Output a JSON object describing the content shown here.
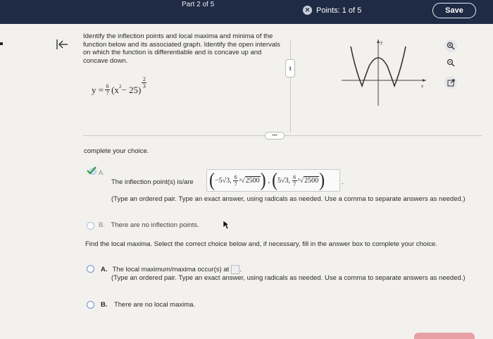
{
  "header": {
    "part_label": "Part 2 of 5",
    "points_label": "Points: 1 of 5",
    "save_label": "Save"
  },
  "problem": {
    "text": "Identify the inflection points and local maxima and minima of the function below and its associated graph. Identify the open intervals on which the function is differentiable and is concave up and concave down.",
    "formula": {
      "lhs": "y =",
      "coef_num": "6",
      "coef_den": "7",
      "base": "(x",
      "sq": "2",
      "rest": " − 25)",
      "exp_num": "2",
      "exp_den": "3"
    }
  },
  "graph": {
    "y_label": "y",
    "x_label": "x"
  },
  "complete_prompt": "complete your choice.",
  "inflection": {
    "option_letter": "A.",
    "label": "The inflection point(s) is/are",
    "points": [
      {
        "x": "−5√3",
        "y_num": "6",
        "y_den": "7",
        "y_idx": "3",
        "y_rad": "2500"
      },
      {
        "x": "5√3",
        "y_num": "6",
        "y_den": "7",
        "y_idx": "3",
        "y_rad": "2500"
      }
    ],
    "separator": ",",
    "end": ".",
    "hint": "(Type an ordered pair. Type an exact answer, using radicals as needed. Use a comma to separate answers as needed.)",
    "option_b_letter": "B.",
    "option_b_text": "There are no inflection points."
  },
  "maxima": {
    "prompt": "Find the local maxima. Select the correct choice below and, if necessary, fill in the answer box to complete your choice.",
    "option_a_letter": "A.",
    "option_a_text": "The local maximum/maxima occur(s) at",
    "option_a_end": ".",
    "hint": "(Type an ordered pair. Type an exact answer, using radicals as needed. Use a comma to separate answers as needed.)",
    "option_b_letter": "B.",
    "option_b_text": "There are no local maxima."
  },
  "colors": {
    "header_bg": "#1f2a44",
    "accent_blue": "#6a8cc8",
    "check_green": "#3a9a3a"
  }
}
